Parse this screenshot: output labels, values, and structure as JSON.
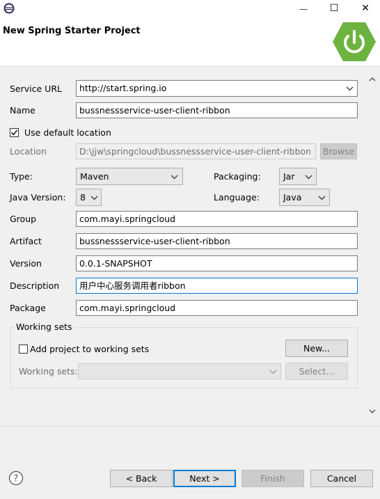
{
  "window": {
    "icon": "eclipse-icon",
    "minimize": "—",
    "maximize": "☐",
    "close": "✕"
  },
  "header": {
    "title": "New Spring Starter Project",
    "logo_icon": "spring-power-icon",
    "accent": "#6db33f"
  },
  "form": {
    "service_url": {
      "label": "Service URL",
      "value": "http://start.spring.io"
    },
    "name": {
      "label": "Name",
      "value": "bussnessservice-user-client-ribbon"
    },
    "use_default_location": {
      "label": "Use default location",
      "checked": true
    },
    "location": {
      "label": "Location",
      "value": "D:\\jjw\\springcloud\\bussnessservice-user-client-ribbon",
      "browse": "Browse"
    },
    "type": {
      "label": "Type:",
      "value": "Maven"
    },
    "packaging": {
      "label": "Packaging:",
      "value": "Jar"
    },
    "java_version": {
      "label": "Java Version:",
      "value": "8"
    },
    "language": {
      "label": "Language:",
      "value": "Java"
    },
    "group": {
      "label": "Group",
      "value": "com.mayi.springcloud"
    },
    "artifact": {
      "label": "Artifact",
      "value": "bussnessservice-user-client-ribbon"
    },
    "version": {
      "label": "Version",
      "value": "0.0.1-SNAPSHOT"
    },
    "description": {
      "label": "Description",
      "value": "用户中心服务调用者ribbon"
    },
    "package": {
      "label": "Package",
      "value": "com.mayi.springcloud"
    }
  },
  "working_sets": {
    "legend": "Working sets",
    "add_label": "Add project to working sets",
    "add_checked": false,
    "new_button": "New...",
    "sets_label": "Working sets:",
    "select_button": "Select..."
  },
  "footer": {
    "help_icon": "help-icon",
    "back": "< Back",
    "next": "Next >",
    "finish": "Finish",
    "cancel": "Cancel"
  }
}
